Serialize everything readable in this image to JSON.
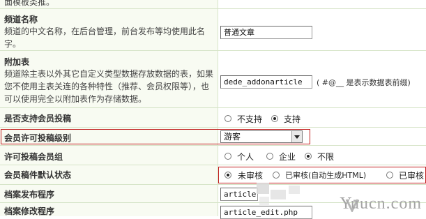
{
  "rows": {
    "top_text": "面模板类推。",
    "channel_name": {
      "label": "频道名称",
      "desc": "频道的中文名称，在后台管理，前台发布等均使用此名字。",
      "value": "普通文章"
    },
    "addon_table": {
      "label": "附加表",
      "desc": "频道除主表以外其它自定义类型数据存放数据的表，如果您不使用主表关连的各种特性（推荐、会员权限等），也可以使用完全以附加表作为存储数据。",
      "value": "dede_addonarticle",
      "hint": "( #@__ 是表示数据表前缀)"
    },
    "member_submit": {
      "label": "是否支持会员投稿",
      "options": [
        "不支持",
        "支持"
      ],
      "selected": 1
    },
    "submit_level": {
      "label": "会员许可投稿级别",
      "value": "游客"
    },
    "submit_group": {
      "label": "许可投稿会员组",
      "options": [
        "个人",
        "企业",
        "不限"
      ],
      "selected": 2
    },
    "default_status": {
      "label": "会员稿件默认状态",
      "options": [
        "未审核",
        "已审核(自动生成HTML)",
        "已审核"
      ],
      "selected": 0
    },
    "publish_program": {
      "label": "档案发布程序",
      "value": "article"
    },
    "edit_program": {
      "label": "档案修改程序",
      "value": "article_edit.php"
    }
  },
  "watermark": "Yuucn.com",
  "colors": {
    "highlight_border": "#c21e1e",
    "row_bg": "#f8fbf2",
    "row_border": "#d6e4c8"
  }
}
